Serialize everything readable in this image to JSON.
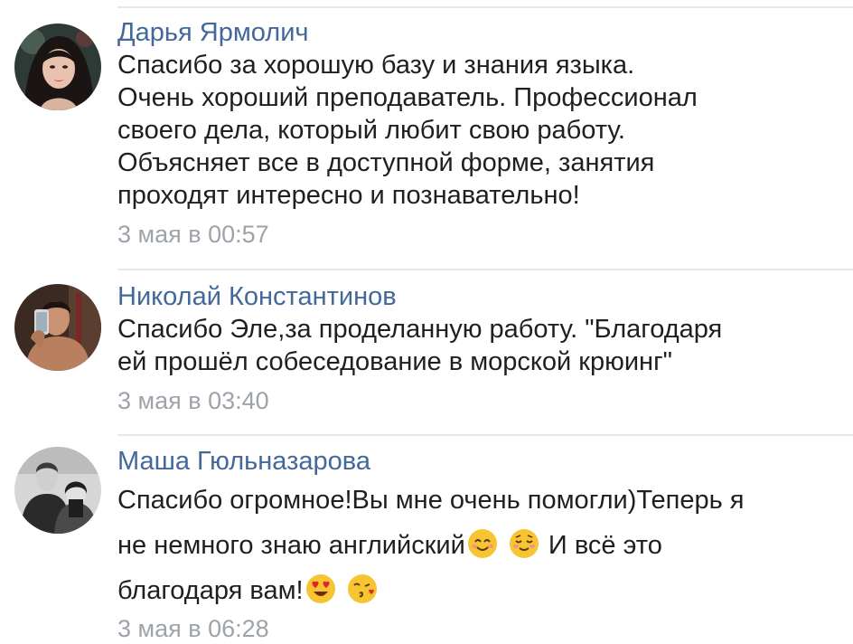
{
  "comments": [
    {
      "author": "Дарья Ярмолич",
      "lines": [
        "Спасибо за хорошую базу и знания языка.",
        "Очень хороший преподаватель. Профессионал",
        "своего дела, который любит свою работу.",
        "Объясняет все в доступной форме, занятия",
        "проходят интересно и познавательно!"
      ],
      "time": "3 мая в 00:57"
    },
    {
      "author": "Николай Константинов",
      "lines": [
        "Спасибо Эле,за проделанную работу. \"Благодаря",
        "ей прошёл собеседование в морской крюинг\""
      ],
      "time": "3 мая в 03:40"
    },
    {
      "author": "Маша Гюльназарова",
      "line1": "Спасибо огромное!Вы мне очень помогли)Теперь я",
      "line2_a": "не немного знаю английский",
      "line2_b": "И всё это",
      "line3": "благодаря вам!",
      "time": "3 мая в 06:28",
      "emojis": [
        "smiling-face-with-smiling-eyes",
        "relieved-smiling-face",
        "heart-eyes-face",
        "face-blowing-kiss"
      ]
    }
  ],
  "colors": {
    "author": "#43689a",
    "text": "#1f1f1f",
    "time": "#9ea3a9",
    "divider": "#e6e8ec"
  }
}
